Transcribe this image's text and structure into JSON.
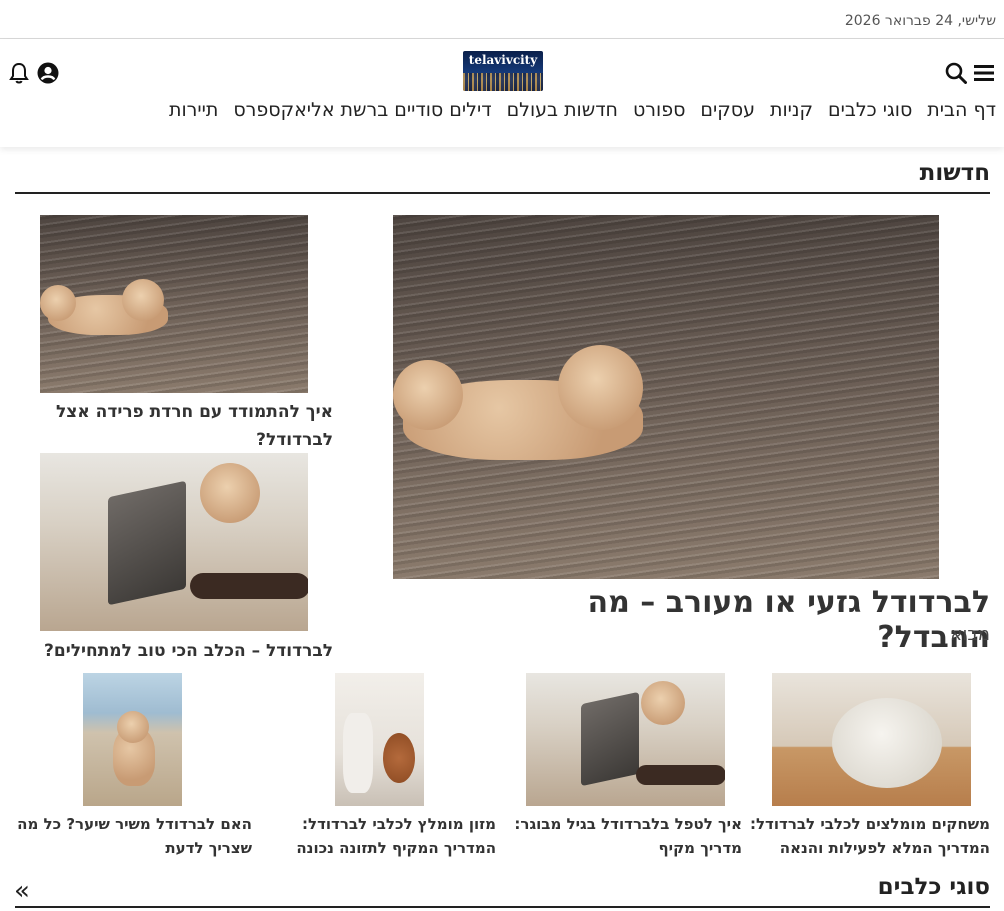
{
  "date": "שלישי, 24 פברואר 2026",
  "logo": {
    "text": "telavivcity"
  },
  "icons": {
    "menu": "menu-icon",
    "search": "search-icon",
    "user": "user-icon",
    "bell": "bell-icon"
  },
  "nav": [
    "דף הבית",
    "סוגי כלבים",
    "קניות",
    "עסקים",
    "ספורט",
    "חדשות בעולם",
    "דילים סודיים ברשת אליאקספרס",
    "תיירות"
  ],
  "news": {
    "section_title": "חדשות",
    "main": {
      "title": "לברדודל גזעי או מעורב – מה ההבדל?",
      "category": "מבוא"
    },
    "side": [
      {
        "title": "איך להתמודד עם חרדת פרידה אצל לברדודל?"
      },
      {
        "title": "לברדודל – הכלב הכי טוב למתחילים?"
      }
    ],
    "row": [
      {
        "title": "משחקים מומלצים לכלבי לברדודל: המדריך המלא לפעילות והנאה"
      },
      {
        "title": "איך לטפל בלברדודל בגיל מבוגר: מדריך מקיף"
      },
      {
        "title": "מזון מומלץ לכלבי לברדודל: המדריך המקיף לתזונה נכונה"
      },
      {
        "title": "האם לברדודל משיר שיער? כל מה שצריך לדעת"
      }
    ]
  },
  "breeds": {
    "section_title": "סוגי כלבים",
    "more_arrow": "»"
  },
  "colors": {
    "text": "#222222",
    "rule": "#222222",
    "muted": "#555555"
  }
}
